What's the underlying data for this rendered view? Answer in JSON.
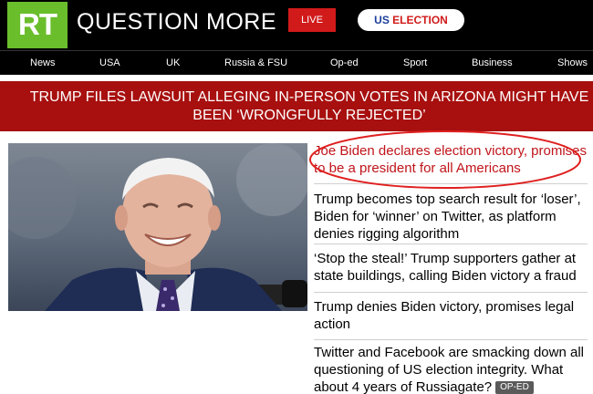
{
  "header": {
    "logo_text": "RT",
    "tagline": "QUESTION MORE",
    "live_label": "LIVE",
    "us_election_label_us": "US",
    "us_election_label_election": "ELECTION"
  },
  "nav": {
    "items": [
      {
        "label": "News"
      },
      {
        "label": "USA"
      },
      {
        "label": "UK"
      },
      {
        "label": "Russia & FSU"
      },
      {
        "label": "Op-ed"
      },
      {
        "label": "Sport"
      },
      {
        "label": "Business"
      },
      {
        "label": "Shows"
      }
    ]
  },
  "banner": {
    "headline": "TRUMP FILES LAWSUIT ALLEGING IN-PERSON VOTES IN ARIZONA MIGHT HAVE BEEN ‘WRONGFULLY REJECTED’"
  },
  "stories": [
    {
      "title": "Joe Biden declares election victory, promises to be a president for all Americans"
    },
    {
      "title": "Trump becomes top search result for ‘loser’, Biden for ‘winner’ on Twitter, as platform denies rigging algorithm"
    },
    {
      "title": "‘Stop the steal!’ Trump supporters gather at state buildings, calling Biden victory a fraud"
    },
    {
      "title": "Trump denies Biden victory, promises legal action"
    },
    {
      "title": "Twitter and Facebook are smacking down all questioning of US election integrity. What about 4 years of Russiagate?",
      "badge": "OP-ED"
    }
  ],
  "colors": {
    "accent_red": "#a7100f",
    "logo_green": "#6abe2c",
    "annotation_red": "#e02020"
  }
}
